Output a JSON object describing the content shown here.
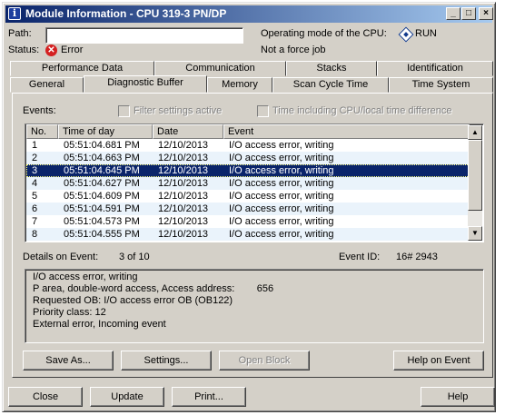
{
  "window": {
    "title": "Module Information - CPU 319-3 PN/DP",
    "minimize": "_",
    "maximize": "□",
    "close": "×"
  },
  "info": {
    "path_label": "Path:",
    "path_value": "",
    "status_label": "Status:",
    "status_value": "Error",
    "op_mode_label": "Operating mode of the  CPU:",
    "op_mode_value": "RUN",
    "force_text": "Not a force job"
  },
  "tabs_back": [
    "Performance Data",
    "Communication",
    "Stacks",
    "Identification"
  ],
  "tabs_front": [
    "General",
    "Diagnostic Buffer",
    "Memory",
    "Scan Cycle Time",
    "Time System"
  ],
  "active_tab": "Diagnostic Buffer",
  "events": {
    "label": "Events:",
    "filter_checkbox": "Filter settings active",
    "time_checkbox": "Time including CPU/local time difference",
    "columns": [
      "No.",
      "Time of day",
      "Date",
      "Event"
    ],
    "rows": [
      [
        "1",
        "05:51:04.681 PM",
        "12/10/2013",
        "I/O access error, writing"
      ],
      [
        "2",
        "05:51:04.663 PM",
        "12/10/2013",
        "I/O access error, writing"
      ],
      [
        "3",
        "05:51:04.645 PM",
        "12/10/2013",
        "I/O access error, writing"
      ],
      [
        "4",
        "05:51:04.627 PM",
        "12/10/2013",
        "I/O access error, writing"
      ],
      [
        "5",
        "05:51:04.609 PM",
        "12/10/2013",
        "I/O access error, writing"
      ],
      [
        "6",
        "05:51:04.591 PM",
        "12/10/2013",
        "I/O access error, writing"
      ],
      [
        "7",
        "05:51:04.573 PM",
        "12/10/2013",
        "I/O access error, writing"
      ],
      [
        "8",
        "05:51:04.555 PM",
        "12/10/2013",
        "I/O access error, writing"
      ]
    ],
    "selected_row": 3
  },
  "details": {
    "label": "Details on Event:",
    "counter": "3 of 10",
    "event_id_label": "Event ID:",
    "event_id_value": "16# 2943",
    "lines": [
      "I/O access error, writing",
      "P area, double-word access, Access address:        656",
      "Requested OB: I/O access error OB (OB122)",
      "Priority class: 12",
      "External error, Incoming event"
    ]
  },
  "buttons": {
    "save_as": "Save As...",
    "settings": "Settings...",
    "open_block": "Open Block",
    "help_on_event": "Help on Event",
    "close": "Close",
    "update": "Update",
    "print": "Print...",
    "help": "Help"
  }
}
